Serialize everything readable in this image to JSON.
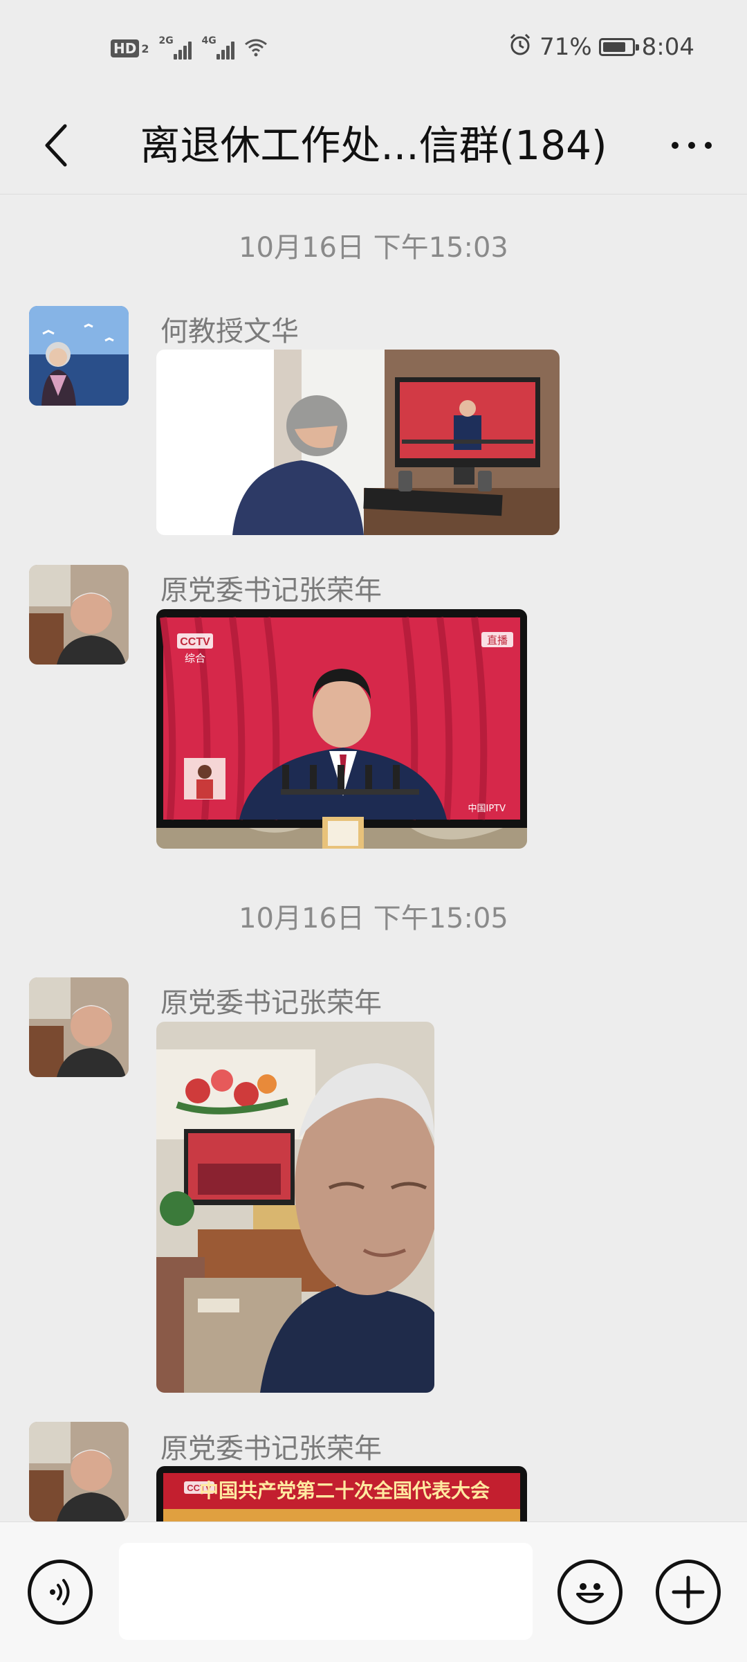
{
  "status_bar": {
    "hd_label": "HD",
    "hd_sub": "2",
    "sim1_label": "2G",
    "sim2_label": "4G",
    "battery_percent": "71%",
    "time": "8:04",
    "icons": [
      "hd-icon",
      "signal-icon",
      "signal-icon",
      "wifi-icon",
      "alarm-icon",
      "battery-charging-icon"
    ]
  },
  "header": {
    "title": "离退休工作处...信群(184)"
  },
  "messages": [
    {
      "type": "timestamp",
      "text": "10月16日 下午15:03"
    },
    {
      "type": "image",
      "sender": "何教授文华",
      "avatar": "avatar-elderly-woman-lake"
    },
    {
      "type": "image",
      "sender": "原党委书记张荣年",
      "avatar": "avatar-elderly-man"
    },
    {
      "type": "timestamp",
      "text": "10月16日 下午15:05"
    },
    {
      "type": "image",
      "sender": "原党委书记张荣年",
      "avatar": "avatar-elderly-man"
    },
    {
      "type": "image",
      "sender": "原党委书记张荣年",
      "avatar": "avatar-elderly-man"
    }
  ],
  "photo_text": {
    "cctv": "CCTV",
    "channel": "综合",
    "live": "直播",
    "watermark": "中国IPTV",
    "banner": "中国共产党第二十次全国代表大会"
  },
  "input_bar": {
    "message_value": "",
    "icons": [
      "voice-icon",
      "emoji-icon",
      "plus-icon"
    ]
  },
  "colors": {
    "background": "#ededed",
    "input_bar": "#f7f7f7",
    "timestamp": "#8a8a8a",
    "sender": "#7a7a7a",
    "tv_red": "#d6284a"
  }
}
